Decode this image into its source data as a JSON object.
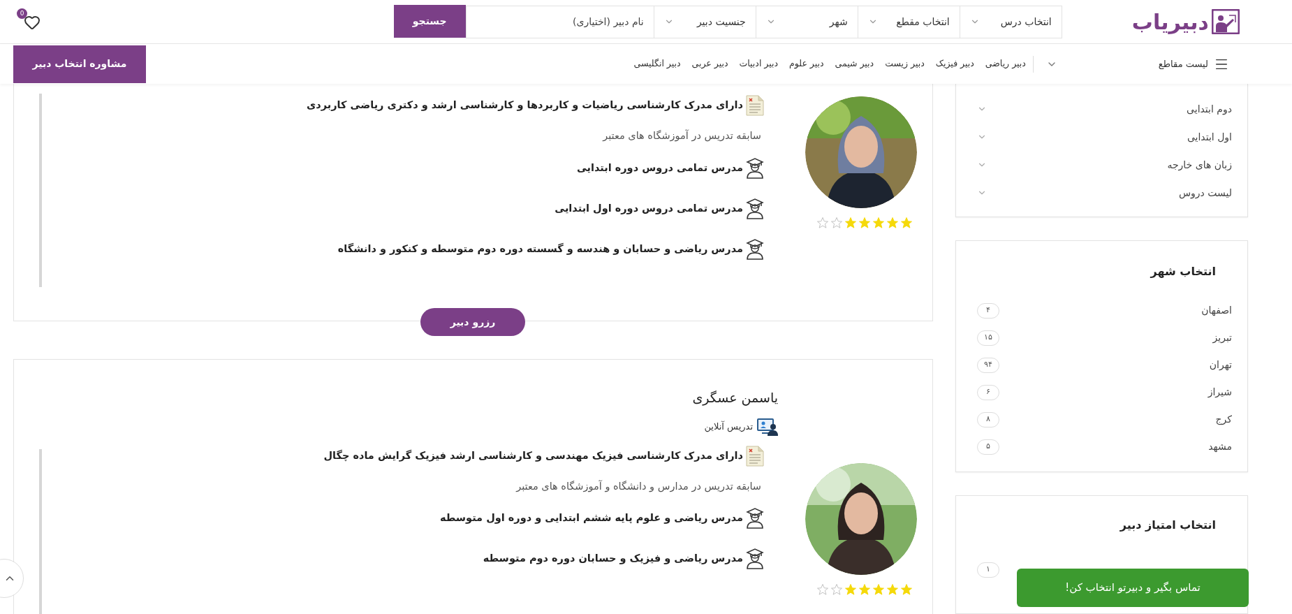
{
  "header": {
    "logo": "دبیریاب",
    "filters": [
      {
        "label": "انتخاب درس"
      },
      {
        "label": "انتخاب مقطع"
      },
      {
        "label": "شهر"
      },
      {
        "label": "جنسیت دبیر"
      }
    ],
    "name_field": {
      "placeholder": "نام دبیر (اختیاری)"
    },
    "search_button": "جستجو",
    "favorites_count": "0"
  },
  "nav": {
    "menu_label": "لیست مقاطع",
    "links": [
      "دبیر ریاضی",
      "دبیر فیزیک",
      "دبیر زیست",
      "دبیر شیمی",
      "دبیر علوم",
      "دبیر ادبیات",
      "دبیر عربی",
      "دبیر انگلیسی"
    ],
    "cta": "مشاوره انتخاب دبیر"
  },
  "teachers": [
    {
      "degree": "دارای مدرک کارشناسی ریاضیات و کاربردها و کارشناسی ارشد و دکتری ریاضی کاربردی",
      "experience": "سابقه تدریس در آموزشگاه های معتبر",
      "courses": [
        "مدرس تمامی دروس دوره ابتدایی",
        "مدرس تمامی دروس دوره اول ابتدایی",
        "مدرس ریاضی و حسابان و هندسه و گسسته دوره دوم متوسطه و کنکور و دانشگاه"
      ],
      "stars": 5,
      "reserve": "رزرو دبیر",
      "photo": {
        "kind": "picture"
      }
    },
    {
      "name": "یاسمن عسگری",
      "online": "تدریس آنلاین",
      "degree": "دارای مدرک کارشناسی فیزیک مهندسی و کارشناسی ارشد فیزیک گرایش ماده چگال",
      "experience": "سابقه تدریس در مدارس و دانشگاه و آموزشگاه های معتبر",
      "courses": [
        "مدرس ریاضی و علوم پایه ششم ابتدایی و دوره اول متوسطه",
        "مدرس ریاضی و فیزیک و حسابان دوره دوم متوسطه"
      ],
      "stars": 5,
      "photo": {
        "kind": "picture"
      }
    }
  ],
  "sidebar": {
    "levels": [
      "دوم ابتدایی",
      "اول ابتدایی",
      "زبان های خارجه",
      "لیست دروس"
    ],
    "cities": {
      "title": "انتخاب شهر",
      "items": [
        {
          "name": "اصفهان",
          "count": "۴"
        },
        {
          "name": "تبریز",
          "count": "۱۵"
        },
        {
          "name": "تهران",
          "count": "۹۴"
        },
        {
          "name": "شیراز",
          "count": "۶"
        },
        {
          "name": "کرج",
          "count": "۸"
        },
        {
          "name": "مشهد",
          "count": "۵"
        }
      ]
    },
    "rating": {
      "title": "انتخاب امتیاز دبیر",
      "items": [
        {
          "count": "۱"
        }
      ]
    }
  },
  "toast": "تماس بگیر و دبیرتو انتخاب کن!"
}
